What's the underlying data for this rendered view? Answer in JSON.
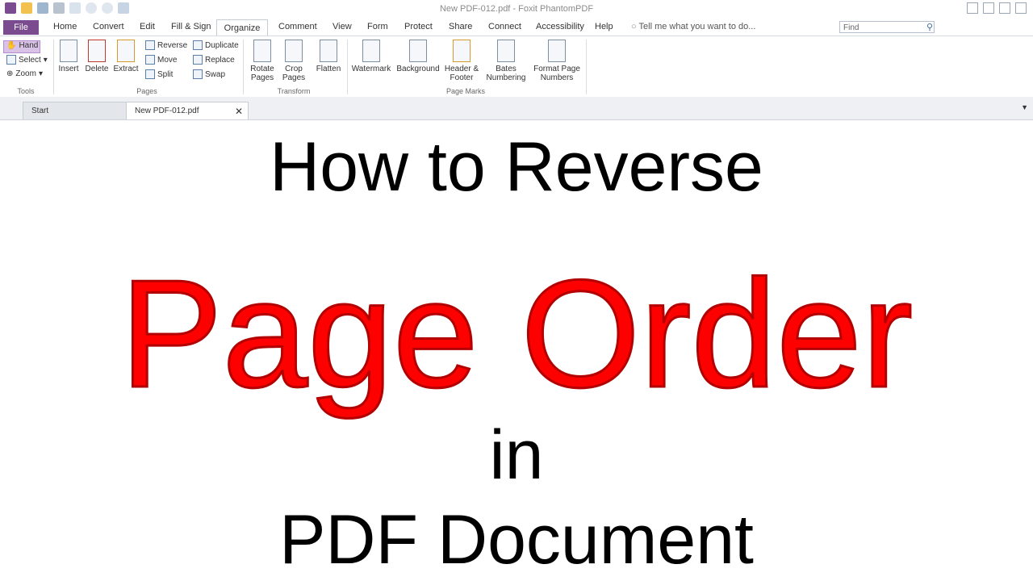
{
  "window": {
    "title": "New PDF-012.pdf - Foxit PhantomPDF"
  },
  "menu": {
    "file": "File",
    "items": [
      "Home",
      "Convert",
      "Edit",
      "Fill & Sign",
      "Organize",
      "Comment",
      "View",
      "Form",
      "Protect",
      "Share",
      "Connect",
      "Accessibility",
      "Help"
    ],
    "active": "Organize",
    "tell_me": "Tell me what you want to do...",
    "search_placeholder": "Find"
  },
  "ribbon": {
    "tools": {
      "hand": "Hand",
      "select": "Select",
      "zoom": "Zoom",
      "label": "Tools"
    },
    "pages": {
      "insert": "Insert",
      "delete": "Delete",
      "extract": "Extract",
      "reverse": "Reverse",
      "move": "Move",
      "split": "Split",
      "duplicate": "Duplicate",
      "replace": "Replace",
      "swap": "Swap",
      "label": "Pages"
    },
    "transform": {
      "rotate": "Rotate Pages",
      "crop": "Crop Pages",
      "flatten": "Flatten",
      "label": "Transform"
    },
    "page_marks": {
      "watermark": "Watermark",
      "background": "Background",
      "header_footer": "Header & Footer",
      "bates": "Bates Numbering",
      "format_page": "Format Page Numbers",
      "label": "Page Marks"
    }
  },
  "doc_tabs": {
    "start": "Start",
    "active": "New PDF-012.pdf"
  },
  "content": {
    "line1": "How to Reverse",
    "line2": "Page Order",
    "line3": "in",
    "line4": "PDF Document"
  },
  "colors": {
    "file_tab": "#7a4b8f",
    "headline_red": "#ff0000"
  }
}
